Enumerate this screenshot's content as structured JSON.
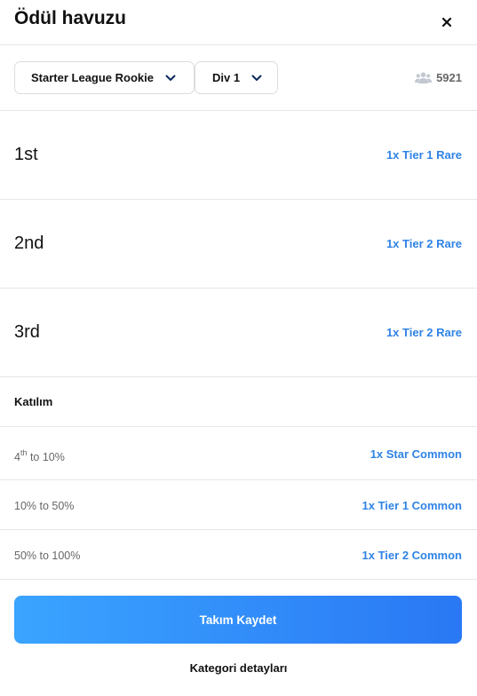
{
  "header": {
    "title": "Ödül havuzu",
    "close_icon": "close-icon"
  },
  "filters": {
    "league": {
      "value": "Starter League Rookie",
      "icon": "chevron-down-icon"
    },
    "division": {
      "value": "Div 1",
      "icon": "chevron-down-icon"
    },
    "participants": {
      "icon": "users-icon",
      "count": "5921"
    }
  },
  "ranks": [
    {
      "label": "1st",
      "reward": "1x Tier 1 Rare"
    },
    {
      "label": "2nd",
      "reward": "1x Tier 2 Rare"
    },
    {
      "label": "3rd",
      "reward": "1x Tier 2 Rare"
    }
  ],
  "participation": {
    "title": "Katılım",
    "rows": [
      {
        "label_num": "4",
        "label_sup": "th",
        "label_rest": " to 10%",
        "reward": "1x Star Common"
      },
      {
        "label": "10% to 50%",
        "reward": "1x Tier 1 Common"
      },
      {
        "label": "50% to 100%",
        "reward": "1x Tier 2 Common"
      }
    ]
  },
  "actions": {
    "save_label": "Takım Kaydet",
    "details_label": "Kategori detayları"
  },
  "colors": {
    "accent": "#2f83e6",
    "button_start": "#3aa4ff",
    "button_end": "#2a78f4",
    "divider": "#e6e6e6"
  }
}
